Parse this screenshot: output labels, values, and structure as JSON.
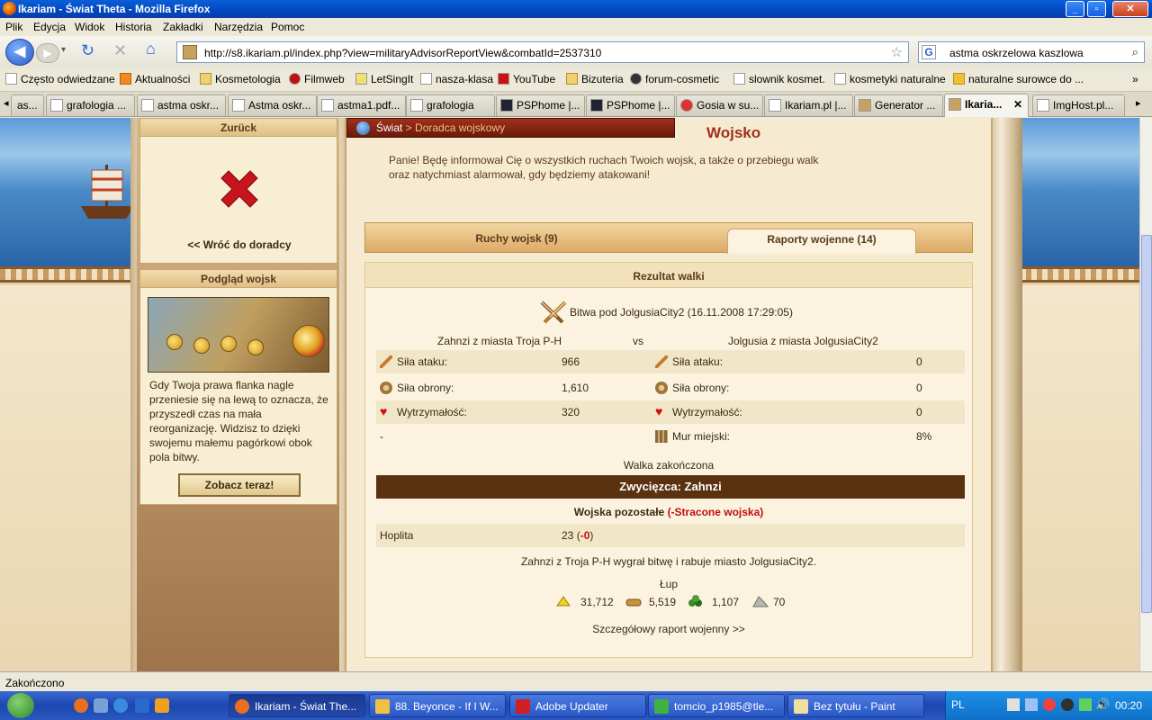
{
  "window": {
    "title": "Ikariam - Świat Theta - Mozilla Firefox"
  },
  "menu": [
    "Plik",
    "Edycja",
    "Widok",
    "Historia",
    "Zakładki",
    "Narzędzia",
    "Pomoc"
  ],
  "nav": {
    "url": "http://s8.ikariam.pl/index.php?view=militaryAdvisorReportView&combatId=2537310",
    "search_value": "astma oskrzelowa kaszlowa"
  },
  "bookmarks": [
    "Często odwiedzane",
    "Aktualności",
    "Kosmetologia",
    "Filmweb",
    "LetSingIt",
    "nasza-klasa",
    "YouTube",
    "Bizuteria",
    "forum-cosmetic",
    "slownik kosmet.",
    "kosmetyki naturalne",
    "naturalne surowce do ..."
  ],
  "tabs": [
    "as...",
    "grafologia ...",
    "astma oskr...",
    "Astma oskr...",
    "astma1.pdf...",
    "grafologia",
    "PSPhome |...",
    "PSPhome |...",
    "Gosia w su...",
    "Ikariam.pl |...",
    "Generator ...",
    "Ikaria...",
    "ImgHost.pl..."
  ],
  "side": {
    "back_box": {
      "title": "Zurück",
      "link": "<< Wróć do doradcy"
    },
    "preview_box": {
      "title": "Podgląd wojsk",
      "text": "Gdy Twoja prawa flanka nagle przeniesie się na lewą to oznacza, że przyszedł czas na mała reorganizację. Widzisz to dzięki swojemu małemu pagórkowi obok pola bitwy.",
      "button": "Zobacz teraz!"
    }
  },
  "main": {
    "breadcrumb": {
      "world": "Świat",
      "sep": " > ",
      "current": "Doradca wojskowy"
    },
    "title": "Wojsko",
    "intro": "Panie! Będę informował Cię o wszystkich ruchach Twoich wojsk, a także o przebiegu walk oraz natychmiast alarmował, gdy będziemy atakowani!",
    "tabs": [
      "Ruchy wojsk (9)",
      "Raporty wojenne (14)"
    ],
    "result": {
      "header": "Rezultat walki",
      "battle": "Bitwa pod JolgusiaCity2 (16.11.2008 17:29:05)",
      "attacker": "Zahnzi z miasta Troja P-H",
      "vs": "vs",
      "defender": "Jolgusia z miasta JolgusiaCity2",
      "stats": {
        "attack_label": "Siła ataku:",
        "defense_label": "Siła obrony:",
        "stamina_label": "Wytrzymałość:",
        "wall_label": "Mur miejski:",
        "att_attack": "966",
        "att_defense": "1,610",
        "att_stamina": "320",
        "att_dash": "-",
        "def_attack": "0",
        "def_defense": "0",
        "def_stamina": "0",
        "def_wall": "8%"
      },
      "ended": "Walka zakończona",
      "winner": "Zwycięzca: Zahnzi",
      "remaining_label": "Wojska pozostałe",
      "lost_label": "(-Stracone wojska)",
      "unit_name": "Hoplita",
      "unit_count": "23",
      "unit_lost": "-0",
      "summary": "Zahnzi z Troja P-H wygrał bitwę i rabuje miasto JolgusiaCity2.",
      "loot_label": "Łup",
      "loot": [
        "31,712",
        "5,519",
        "1,107",
        "70"
      ],
      "detail_link": "Szczegółowy raport wojenny >>"
    }
  },
  "status": "Zakończono",
  "taskbar": {
    "items": [
      "Ikariam - Świat The...",
      "88. Beyonce - If I W...",
      "Adobe Updater",
      "tomcio_p1985@tle...",
      "Bez tytułu - Paint"
    ],
    "lang": "PL",
    "clock": "00:20"
  },
  "colors": {
    "accent": "#a0301a",
    "winner_bar": "#5a3210",
    "lost": "#c01010"
  }
}
